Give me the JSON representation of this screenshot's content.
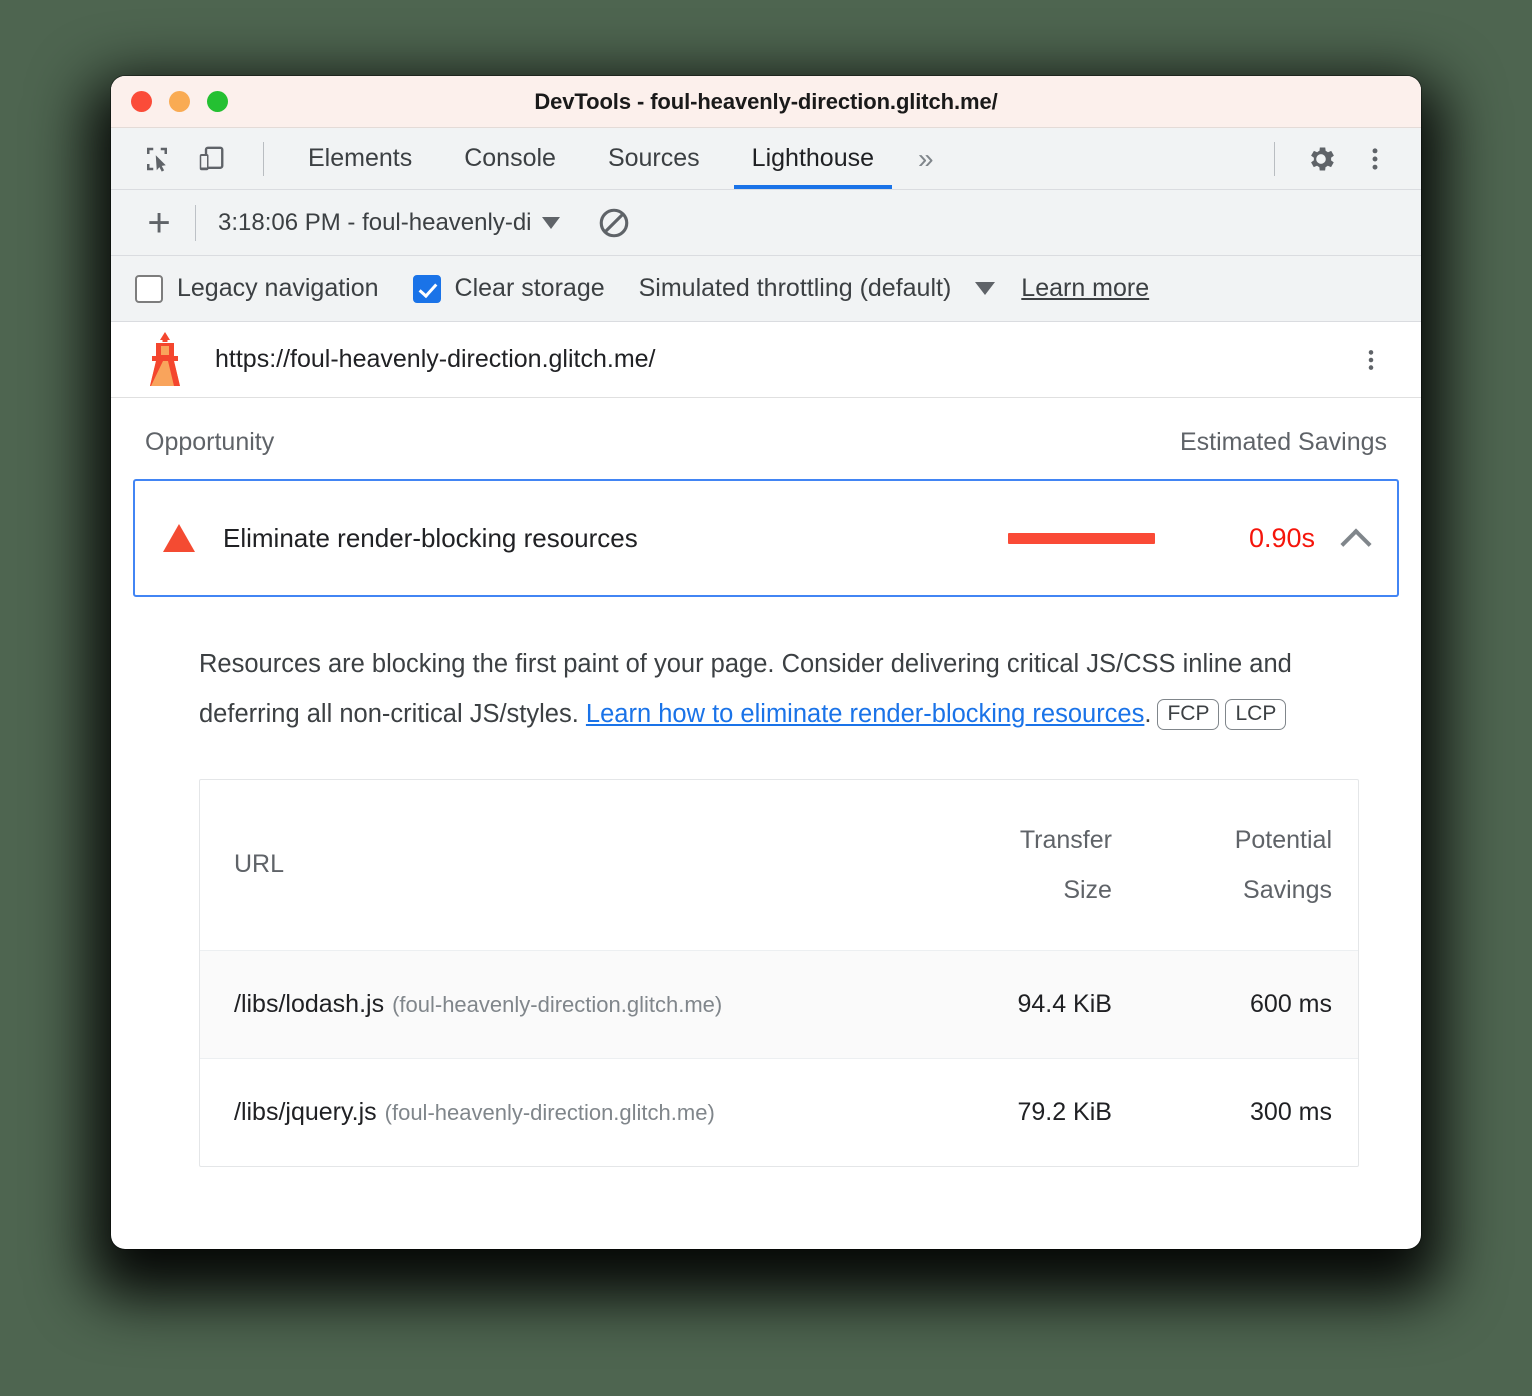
{
  "window": {
    "title": "DevTools - foul-heavenly-direction.glitch.me/",
    "traffic_lights": [
      "close",
      "minimize",
      "zoom"
    ]
  },
  "tabbar": {
    "icons": [
      {
        "name": "inspect-element-icon"
      },
      {
        "name": "device-toolbar-icon"
      }
    ],
    "tabs": [
      {
        "label": "Elements",
        "active": false
      },
      {
        "label": "Console",
        "active": false
      },
      {
        "label": "Sources",
        "active": false
      },
      {
        "label": "Lighthouse",
        "active": true
      }
    ],
    "more_tabs": "»",
    "right_buttons": [
      {
        "name": "settings-gear-icon"
      },
      {
        "name": "more-options-kebab-icon"
      }
    ],
    "active_tab_color": "#1a73e8"
  },
  "runbar": {
    "new_report_label": "+",
    "report_select_value": "3:18:06 PM - foul-heavenly-di",
    "clear_all_icon": "block-icon"
  },
  "settings": {
    "legacy_navigation": {
      "label": "Legacy navigation",
      "checked": false
    },
    "clear_storage": {
      "label": "Clear storage",
      "checked": true
    },
    "throttling": {
      "label": "Simulated throttling (default)"
    },
    "learn_more": "Learn more",
    "checkbox_accent": "#1a73e8"
  },
  "report": {
    "lighthouse_icon": "lighthouse-icon",
    "url": "https://foul-heavenly-direction.glitch.me/",
    "kebab_icon": "report-options-kebab-icon",
    "columns": {
      "opportunity": "Opportunity",
      "estimated_savings": "Estimated Savings"
    },
    "opportunity": {
      "severity_icon": "warning-triangle-icon",
      "title": "Eliminate render-blocking resources",
      "savings_value": "0.90s",
      "savings_color": "#f5150b",
      "bar_color": "#fa4a36",
      "expanded": true,
      "toggle_icon": "chevron-up-icon",
      "description_part1": "Resources are blocking the first paint of your page. Consider delivering critical JS/CSS inline and deferring all non-critical JS/styles. ",
      "description_link": "Learn how to eliminate render-blocking resources",
      "description_part2": ".",
      "metric_badges": [
        "FCP",
        "LCP"
      ]
    },
    "table": {
      "headers": {
        "url": "URL",
        "transfer_size_line1": "Transfer",
        "transfer_size_line2": "Size",
        "potential_savings_line1": "Potential",
        "potential_savings_line2": "Savings"
      },
      "rows": [
        {
          "path": "/libs/lodash.js",
          "origin": "(foul-heavenly-direction.glitch.me)",
          "transfer_size": "94.4 KiB",
          "potential_savings": "600 ms"
        },
        {
          "path": "/libs/jquery.js",
          "origin": "(foul-heavenly-direction.glitch.me)",
          "transfer_size": "79.2 KiB",
          "potential_savings": "300 ms"
        }
      ]
    }
  }
}
